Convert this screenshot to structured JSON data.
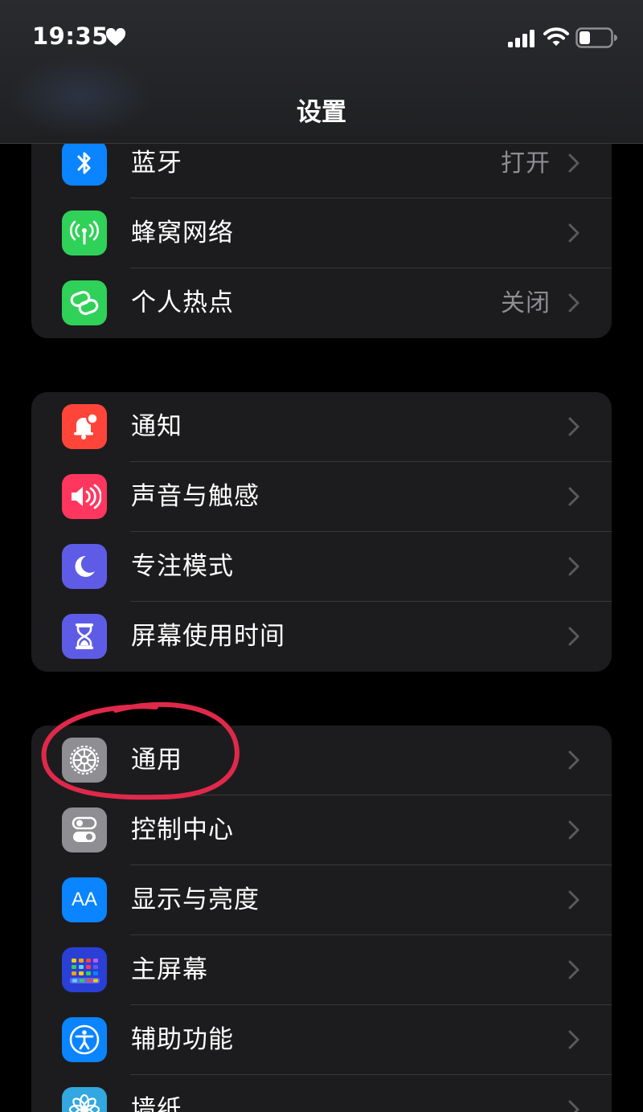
{
  "status_bar": {
    "time": "19:35"
  },
  "header": {
    "title": "设置"
  },
  "colors": {
    "bluetooth": "#0a84ff",
    "cellular": "#30d158",
    "hotspot": "#30d158",
    "notifications": "#ff453a",
    "sounds": "#ff375f",
    "focus": "#5e5ce6",
    "screen_time": "#5e5ce6",
    "general": "#8e8e93",
    "control_center": "#8e8e93",
    "display": "#0a84ff",
    "home_screen": "#2a3fd6",
    "accessibility": "#0a84ff",
    "wallpaper": "#33a7e0",
    "annotation": "#e0294a"
  },
  "groups": [
    {
      "items": [
        {
          "label": "蓝牙",
          "value": "打开",
          "icon": "bluetooth-icon"
        },
        {
          "label": "蜂窝网络",
          "value": "",
          "icon": "antenna-icon"
        },
        {
          "label": "个人热点",
          "value": "关闭",
          "icon": "hotspot-chain-icon"
        }
      ]
    },
    {
      "items": [
        {
          "label": "通知",
          "icon": "bell-icon"
        },
        {
          "label": "声音与触感",
          "icon": "speaker-icon"
        },
        {
          "label": "专注模式",
          "icon": "moon-icon"
        },
        {
          "label": "屏幕使用时间",
          "icon": "hourglass-icon"
        }
      ]
    },
    {
      "items": [
        {
          "label": "通用",
          "icon": "gear-icon"
        },
        {
          "label": "控制中心",
          "icon": "toggles-icon"
        },
        {
          "label": "显示与亮度",
          "icon": "text-size-icon",
          "icon_text": "AA"
        },
        {
          "label": "主屏幕",
          "icon": "app-grid-icon"
        },
        {
          "label": "辅助功能",
          "icon": "accessibility-icon"
        },
        {
          "label": "墙纸",
          "icon": "flower-icon"
        }
      ]
    }
  ]
}
